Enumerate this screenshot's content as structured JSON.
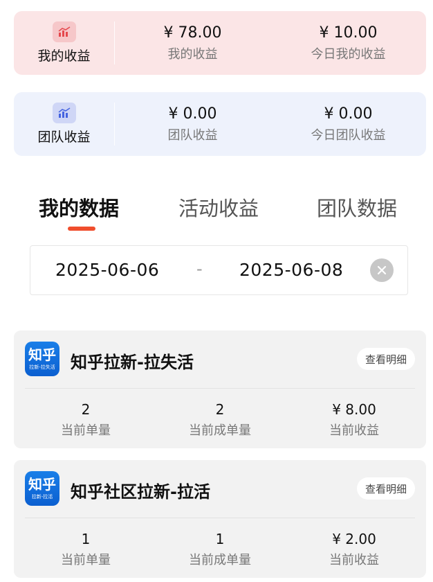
{
  "my_earnings_card": {
    "label": "我的收益",
    "stats": [
      {
        "value": "¥ 78.00",
        "label": "我的收益"
      },
      {
        "value": "¥ 10.00",
        "label": "今日我的收益"
      }
    ],
    "icon": "chart-icon",
    "accent": "#fbe5e6"
  },
  "team_earnings_card": {
    "label": "团队收益",
    "stats": [
      {
        "value": "¥ 0.00",
        "label": "团队收益"
      },
      {
        "value": "¥ 0.00",
        "label": "今日团队收益"
      }
    ],
    "icon": "chart-icon",
    "accent": "#eef2fc"
  },
  "tabs": [
    {
      "label": "我的数据",
      "active": true
    },
    {
      "label": "活动收益",
      "active": false
    },
    {
      "label": "团队数据",
      "active": false
    }
  ],
  "tab_indicator_color": "#f04e2d",
  "date_range": {
    "start": "2025-06-06",
    "separator": "-",
    "end": "2025-06-08"
  },
  "tasks": [
    {
      "logo_text": "知乎",
      "logo_subtext": "拉新-拉失活",
      "title": "知乎拉新-拉失活",
      "detail_label": "查看明细",
      "stats": [
        {
          "value": "2",
          "label": "当前单量"
        },
        {
          "value": "2",
          "label": "当前成单量"
        },
        {
          "value": "¥ 8.00",
          "label": "当前收益"
        }
      ]
    },
    {
      "logo_text": "知乎",
      "logo_subtext": "拉新-拉活",
      "title": "知乎社区拉新-拉活",
      "detail_label": "查看明细",
      "stats": [
        {
          "value": "1",
          "label": "当前单量"
        },
        {
          "value": "1",
          "label": "当前成单量"
        },
        {
          "value": "¥ 2.00",
          "label": "当前收益"
        }
      ]
    }
  ]
}
